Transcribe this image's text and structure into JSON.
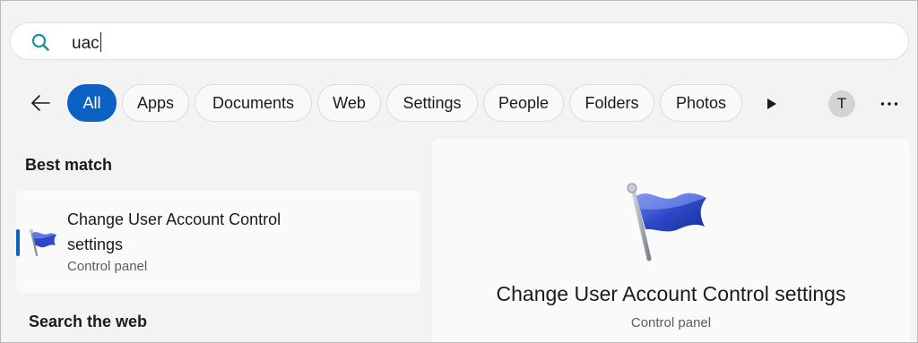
{
  "search": {
    "query": "uac"
  },
  "filters": {
    "chips": [
      {
        "label": "All",
        "active": true
      },
      {
        "label": "Apps",
        "active": false
      },
      {
        "label": "Documents",
        "active": false
      },
      {
        "label": "Web",
        "active": false
      },
      {
        "label": "Settings",
        "active": false
      },
      {
        "label": "People",
        "active": false
      },
      {
        "label": "Folders",
        "active": false
      },
      {
        "label": "Photos",
        "active": false
      }
    ],
    "icons": {
      "back": "back-arrow-icon",
      "more": "play-arrow-icon",
      "overflow": "more-horizontal-icon"
    }
  },
  "account": {
    "initial": "T"
  },
  "best_match": {
    "heading": "Best match",
    "result": {
      "title": "Change User Account Control settings",
      "subtitle": "Control panel",
      "icon": "uac-flag-icon"
    }
  },
  "search_the_web": {
    "heading": "Search the web"
  },
  "preview": {
    "title": "Change User Account Control settings",
    "subtitle": "Control panel",
    "icon": "uac-flag-icon"
  },
  "colors": {
    "accent": "#0b62c4",
    "search_icon": "#1a8f9c",
    "flag_blue": "#2c48c8"
  }
}
